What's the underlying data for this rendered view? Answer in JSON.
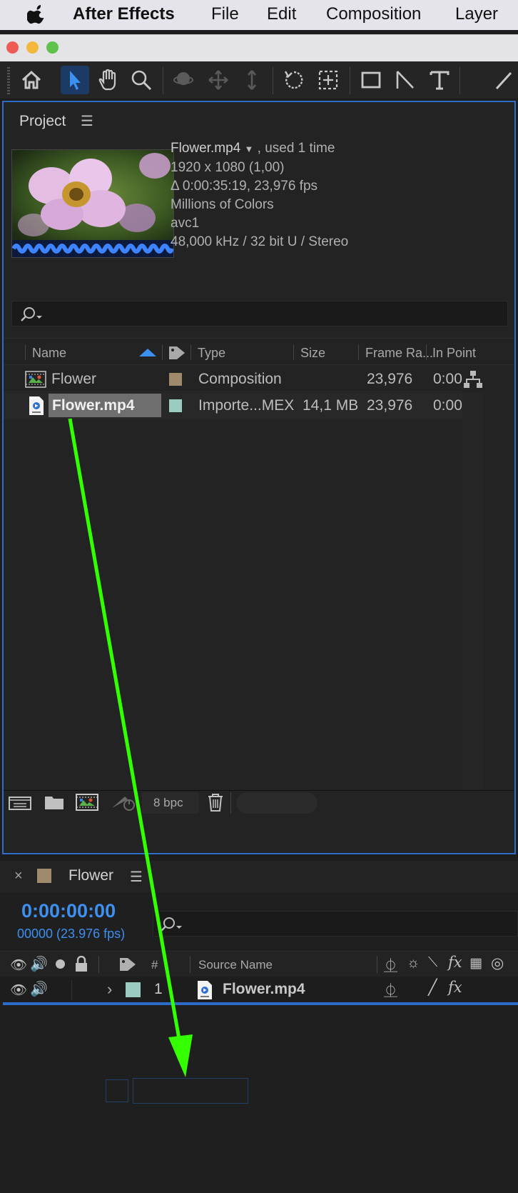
{
  "menubar": {
    "app_name": "After Effects",
    "items": [
      "File",
      "Edit",
      "Composition",
      "Layer"
    ]
  },
  "project_panel": {
    "title": "Project",
    "asset": {
      "name": "Flower.mp4",
      "used": ", used 1 time",
      "resolution": "1920 x 1080 (1,00)",
      "duration_fps": "Δ 0:00:35:19, 23,976 fps",
      "colors": "Millions of Colors",
      "codec": "avc1",
      "audio": "48,000 kHz / 32 bit U / Stereo"
    },
    "columns": [
      "Name",
      "Type",
      "Size",
      "Frame Ra...",
      "In Point"
    ],
    "rows": [
      {
        "name": "Flower",
        "type": "Composition",
        "size": "",
        "frame_rate": "23,976",
        "in_point": "0:00",
        "label_color": "#a08a6c",
        "selected": false
      },
      {
        "name": "Flower.mp4",
        "type": "Importe...MEX",
        "size": "14,1 MB",
        "frame_rate": "23,976",
        "in_point": "0:00",
        "label_color": "#9ccbc2",
        "selected": true
      }
    ],
    "bpc": "8 bpc"
  },
  "timeline": {
    "comp_name": "Flower",
    "timecode": "0:00:00:00",
    "frame_info": "00000 (23.976 fps)",
    "col_number": "#",
    "col_source": "Source Name",
    "layer": {
      "number": "1",
      "name": "Flower.mp4",
      "label_color": "#9ccbc2"
    }
  },
  "colors": {
    "accent_blue": "#2d6cc8",
    "timecode_blue": "#3d8ff0",
    "annotation_green": "#33ff00"
  }
}
